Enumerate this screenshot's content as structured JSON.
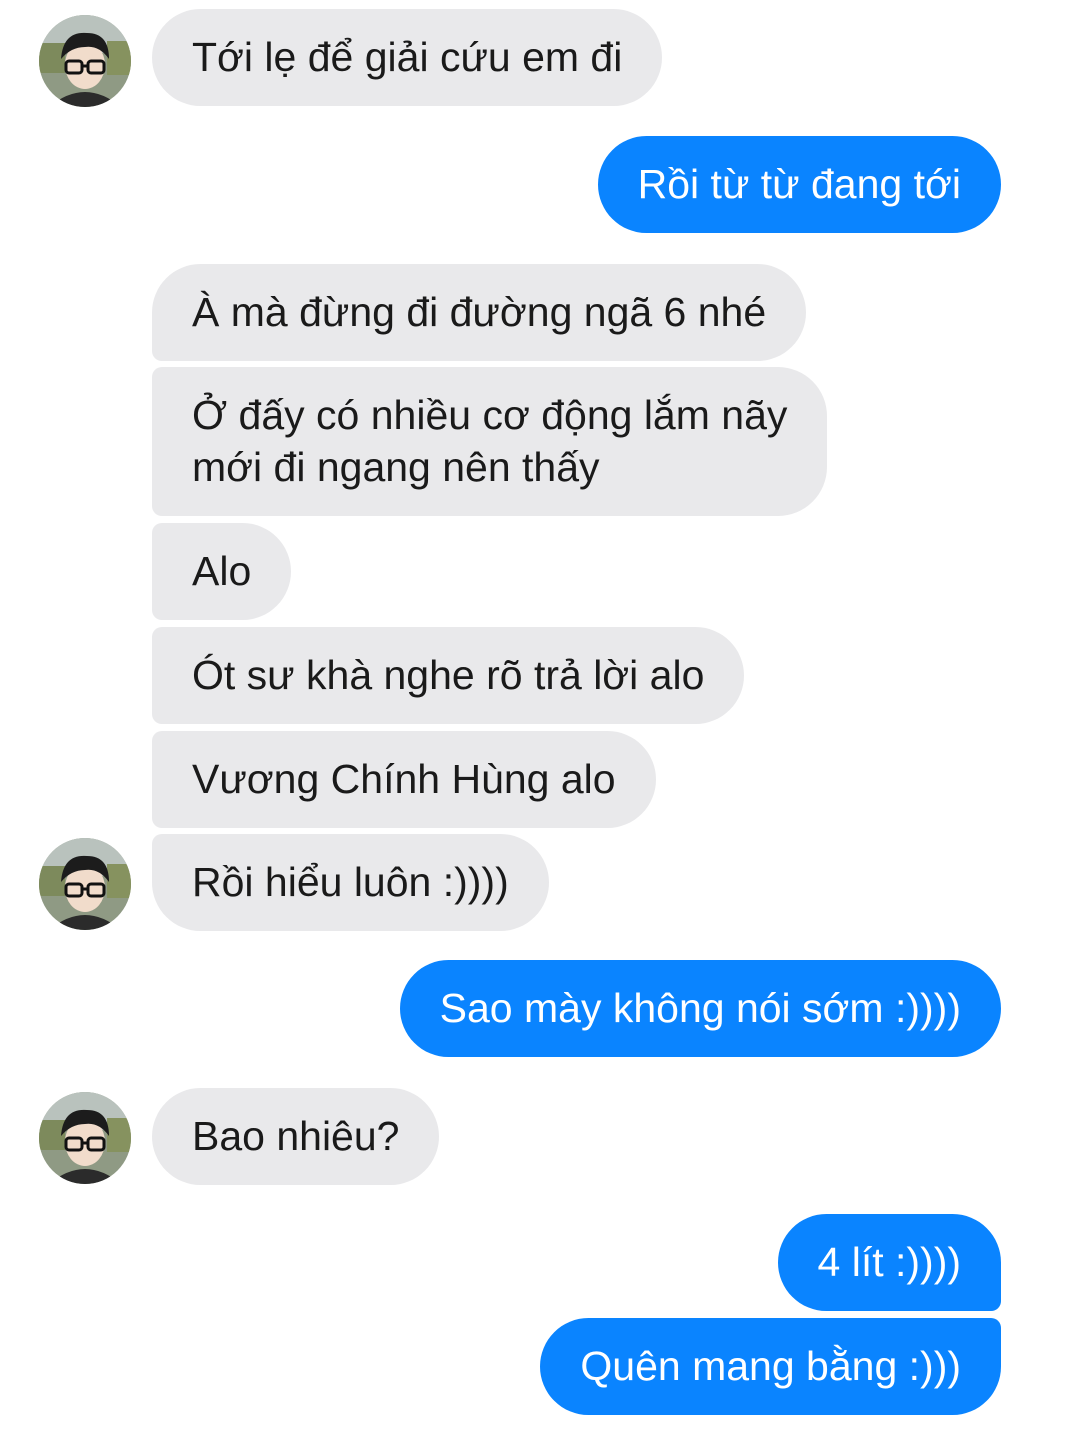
{
  "colors": {
    "incoming_bubble": "#e9e9eb",
    "outgoing_bubble": "#0a84ff",
    "incoming_text": "#1a1a1a",
    "outgoing_text": "#ffffff"
  },
  "messages": [
    {
      "direction": "incoming",
      "text": "Tới lẹ để giải cứu em đi",
      "avatar": "contact-avatar"
    },
    {
      "direction": "outgoing",
      "text": "Rồi từ từ đang tới"
    },
    {
      "direction": "incoming",
      "text": "À mà đừng đi đường ngã 6 nhé"
    },
    {
      "direction": "incoming",
      "lines": [
        "Ở đấy có nhiều cơ động lắm nãy",
        "mới đi ngang nên thấy"
      ]
    },
    {
      "direction": "incoming",
      "text": "Alo"
    },
    {
      "direction": "incoming",
      "text": "Ót sư khà nghe rõ trả lời alo"
    },
    {
      "direction": "incoming",
      "text": "Vương Chính Hùng alo"
    },
    {
      "direction": "incoming",
      "text": "Rồi hiểu luôn :))))",
      "avatar": "contact-avatar"
    },
    {
      "direction": "outgoing",
      "text": "Sao mày không nói sớm :))))"
    },
    {
      "direction": "incoming",
      "text": "Bao nhiêu?",
      "avatar": "contact-avatar"
    },
    {
      "direction": "outgoing",
      "text": "4 lít :))))"
    },
    {
      "direction": "outgoing",
      "text": "Quên mang bằng :)))"
    }
  ]
}
